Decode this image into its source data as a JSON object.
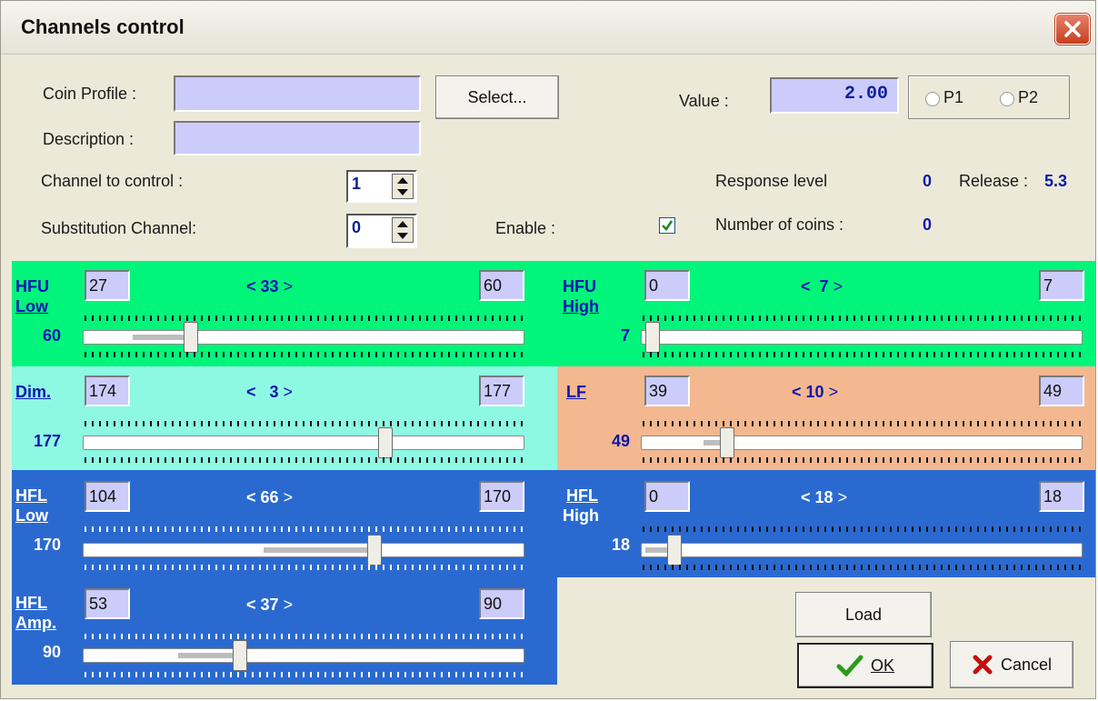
{
  "window": {
    "title": "Channels control",
    "close_icon": "close-icon"
  },
  "form": {
    "coin_profile_label": "Coin Profile :",
    "coin_profile_value": "",
    "description_label": "Description :",
    "description_value": "",
    "select_button": "Select...",
    "value_label": "Value :",
    "value": "2.00",
    "p1_label": "P1",
    "p2_label": "P2",
    "channel_label": "Channel to control :",
    "channel_value": "1",
    "substitution_label": "Substitution  Channel:",
    "substitution_value": "0",
    "enable_label": "Enable :",
    "enable_checked": true,
    "response_label": "Response level",
    "response_value": "0",
    "release_label": "Release :",
    "release_value": "5.3",
    "coins_label": "Number of coins :",
    "coins_value": "0"
  },
  "panels": [
    {
      "key": "hfu_low",
      "name1": "HFU",
      "name2": "Low",
      "min": "27",
      "max": "60",
      "range": "33",
      "current": "60",
      "color": "#00f57a"
    },
    {
      "key": "hfu_high",
      "name1": "HFU",
      "name2": "High",
      "min": "0",
      "max": "7",
      "range": "7",
      "current": "7",
      "color": "#00f57a"
    },
    {
      "key": "dim",
      "name1": "Dim.",
      "name2": "",
      "min": "174",
      "max": "177",
      "range": "3",
      "current": "177",
      "color": "#8ef9e3"
    },
    {
      "key": "lf",
      "name1": "LF",
      "name2": "",
      "min": "39",
      "max": "49",
      "range": "10",
      "current": "49",
      "color": "#f3b88f"
    },
    {
      "key": "hfl_low",
      "name1": "HFL",
      "name2": "Low",
      "min": "104",
      "max": "170",
      "range": "66",
      "current": "170",
      "color": "#2a6ad0"
    },
    {
      "key": "hfl_high",
      "name1": "HFL",
      "name2": "High",
      "min": "0",
      "max": "18",
      "range": "18",
      "current": "18",
      "color": "#2a6ad0"
    },
    {
      "key": "hfl_amp",
      "name1": "HFL",
      "name2": "Amp.",
      "min": "53",
      "max": "90",
      "range": "37",
      "current": "90",
      "color": "#2a6ad0"
    }
  ],
  "buttons": {
    "load": "Load",
    "ok": "OK",
    "cancel": "Cancel"
  }
}
